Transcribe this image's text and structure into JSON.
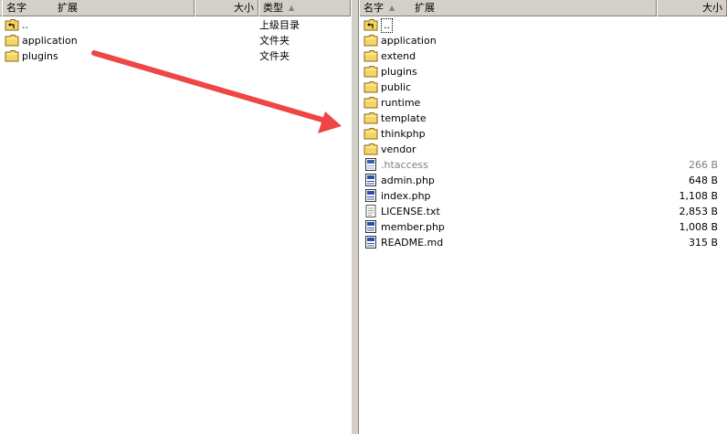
{
  "left": {
    "headers": {
      "name": "名字",
      "ext": "扩展",
      "size": "大小",
      "type": "类型",
      "sort_indicator": "▲"
    },
    "rows": [
      {
        "name": "..",
        "type": "上级目录",
        "icon": "folder-up-icon"
      },
      {
        "name": "application",
        "type": "文件夹",
        "icon": "folder-icon"
      },
      {
        "name": "plugins",
        "type": "文件夹",
        "icon": "folder-icon"
      }
    ]
  },
  "right": {
    "headers": {
      "name": "名字",
      "ext": "扩展",
      "size": "大小",
      "sort_indicator": "▲"
    },
    "rows": [
      {
        "name": "..",
        "size": "",
        "icon": "folder-up-icon"
      },
      {
        "name": "application",
        "size": "",
        "icon": "folder-icon"
      },
      {
        "name": "extend",
        "size": "",
        "icon": "folder-icon"
      },
      {
        "name": "plugins",
        "size": "",
        "icon": "folder-icon"
      },
      {
        "name": "public",
        "size": "",
        "icon": "folder-icon"
      },
      {
        "name": "runtime",
        "size": "",
        "icon": "folder-icon"
      },
      {
        "name": "template",
        "size": "",
        "icon": "folder-icon"
      },
      {
        "name": "thinkphp",
        "size": "",
        "icon": "folder-icon"
      },
      {
        "name": "vendor",
        "size": "",
        "icon": "folder-icon"
      },
      {
        "name": ".htaccess",
        "size": "266 B",
        "icon": "file-icon",
        "hidden": true
      },
      {
        "name": "admin.php",
        "size": "648 B",
        "icon": "php-file-icon"
      },
      {
        "name": "index.php",
        "size": "1,108 B",
        "icon": "php-file-icon"
      },
      {
        "name": "LICENSE.txt",
        "size": "2,853 B",
        "icon": "text-file-icon"
      },
      {
        "name": "member.php",
        "size": "1,008 B",
        "icon": "php-file-icon"
      },
      {
        "name": "README.md",
        "size": "315 B",
        "icon": "php-file-icon"
      }
    ]
  },
  "colors": {
    "annotation_arrow": "#f04545",
    "folder": "#f5d565",
    "header_bg": "#d4d0c8"
  }
}
